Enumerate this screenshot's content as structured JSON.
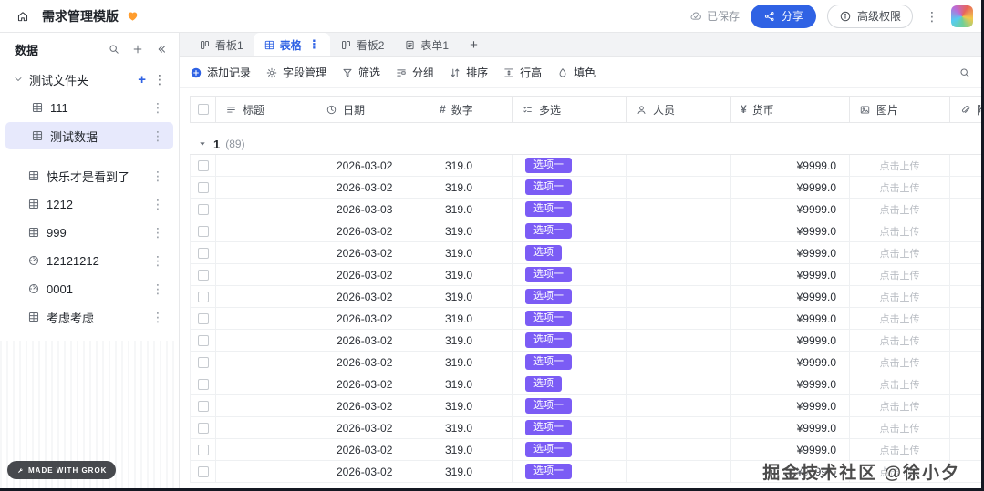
{
  "colors": {
    "accent": "#2f62e4",
    "tag": "#7b5cf5",
    "heart": "#ff9d2e"
  },
  "header": {
    "title": "需求管理模版",
    "saved": "已保存",
    "share": "分享",
    "permissions": "高级权限"
  },
  "sidebar": {
    "title": "数据",
    "folder": "测试文件夹",
    "items": [
      {
        "label": "111",
        "icon": "table",
        "indent": 1,
        "active": false
      },
      {
        "label": "测试数据",
        "icon": "table",
        "indent": 1,
        "active": true
      },
      {
        "label": "快乐才是看到了",
        "icon": "table",
        "indent": 0,
        "active": false
      },
      {
        "label": "1212",
        "icon": "table",
        "indent": 0,
        "active": false
      },
      {
        "label": "999",
        "icon": "table",
        "indent": 0,
        "active": false
      },
      {
        "label": "12121212",
        "icon": "dashboard",
        "indent": 0,
        "active": false
      },
      {
        "label": "0001",
        "icon": "dashboard",
        "indent": 0,
        "active": false
      },
      {
        "label": "考虑考虑",
        "icon": "table",
        "indent": 0,
        "active": false
      }
    ]
  },
  "tabs": [
    {
      "label": "看板1",
      "icon": "kanban",
      "active": false
    },
    {
      "label": "表格",
      "icon": "grid",
      "active": true
    },
    {
      "label": "看板2",
      "icon": "kanban",
      "active": false
    },
    {
      "label": "表单1",
      "icon": "form",
      "active": false
    }
  ],
  "toolbar": {
    "items": [
      {
        "name": "add-record",
        "label": "添加记录",
        "icon": "pluscircle"
      },
      {
        "name": "field-manage",
        "label": "字段管理",
        "icon": "gear"
      },
      {
        "name": "filter",
        "label": "筛选",
        "icon": "funnel"
      },
      {
        "name": "group",
        "label": "分组",
        "icon": "group"
      },
      {
        "name": "sort",
        "label": "排序",
        "icon": "sort"
      },
      {
        "name": "row-height",
        "label": "行高",
        "icon": "rowheight"
      },
      {
        "name": "fill-color",
        "label": "填色",
        "icon": "fill"
      }
    ]
  },
  "table": {
    "columns": [
      {
        "label": "标题",
        "icon": "text"
      },
      {
        "label": "日期",
        "icon": "clock"
      },
      {
        "label": "数字",
        "icon": "hash"
      },
      {
        "label": "多选",
        "icon": "multiselect"
      },
      {
        "label": "人员",
        "icon": "person"
      },
      {
        "label": "货币",
        "icon": "currency"
      },
      {
        "label": "图片",
        "icon": "image"
      },
      {
        "label": "附件",
        "icon": "attachment"
      }
    ],
    "group": {
      "name": "1",
      "count": "(89)"
    },
    "upload_label": "点击上传",
    "rows": [
      {
        "date": "2026-03-02",
        "number": "319.0",
        "tag": "选项一",
        "currency": "¥9999.0"
      },
      {
        "date": "2026-03-02",
        "number": "319.0",
        "tag": "选项一",
        "currency": "¥9999.0"
      },
      {
        "date": "2026-03-03",
        "number": "319.0",
        "tag": "选项一",
        "currency": "¥9999.0"
      },
      {
        "date": "2026-03-02",
        "number": "319.0",
        "tag": "选项一",
        "currency": "¥9999.0"
      },
      {
        "date": "2026-03-02",
        "number": "319.0",
        "tag": "选项",
        "currency": "¥9999.0"
      },
      {
        "date": "2026-03-02",
        "number": "319.0",
        "tag": "选项一",
        "currency": "¥9999.0"
      },
      {
        "date": "2026-03-02",
        "number": "319.0",
        "tag": "选项一",
        "currency": "¥9999.0"
      },
      {
        "date": "2026-03-02",
        "number": "319.0",
        "tag": "选项一",
        "currency": "¥9999.0"
      },
      {
        "date": "2026-03-02",
        "number": "319.0",
        "tag": "选项一",
        "currency": "¥9999.0"
      },
      {
        "date": "2026-03-02",
        "number": "319.0",
        "tag": "选项一",
        "currency": "¥9999.0"
      },
      {
        "date": "2026-03-02",
        "number": "319.0",
        "tag": "选项",
        "currency": "¥9999.0"
      },
      {
        "date": "2026-03-02",
        "number": "319.0",
        "tag": "选项一",
        "currency": "¥9999.0"
      },
      {
        "date": "2026-03-02",
        "number": "319.0",
        "tag": "选项一",
        "currency": "¥9999.0"
      },
      {
        "date": "2026-03-02",
        "number": "319.0",
        "tag": "选项一",
        "currency": "¥9999.0"
      },
      {
        "date": "2026-03-02",
        "number": "319.0",
        "tag": "选项一",
        "currency": "¥9999.0"
      }
    ]
  },
  "footer": {
    "badge": "MADE WITH GROK",
    "credit": "掘金技术社区 @徐小夕"
  }
}
